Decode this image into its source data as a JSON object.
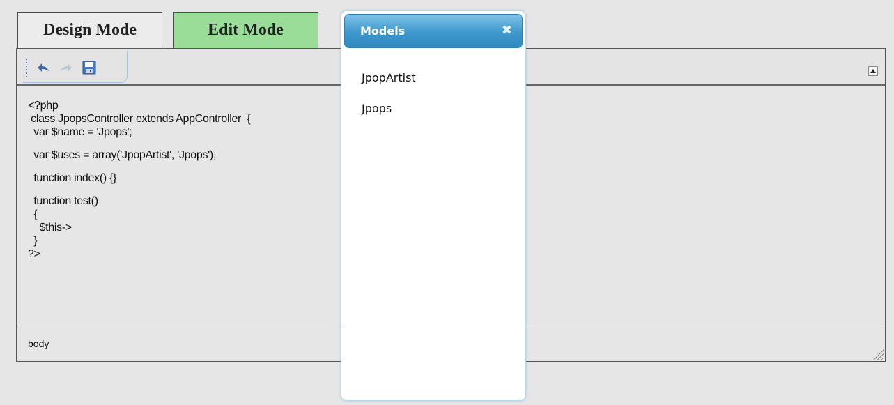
{
  "tabs": {
    "design_label": "Design Mode",
    "edit_label": "Edit Mode"
  },
  "toolbar": {
    "undo_icon": "undo-icon",
    "redo_icon": "redo-icon",
    "save_icon": "save-icon"
  },
  "code": {
    "lines": [
      "<?php",
      " class JpopsController extends AppController  {",
      "  var $name = 'Jpops';",
      "",
      "  var $uses = array('JpopArtist', 'Jpops');",
      "",
      "  function index() {}",
      "",
      "  function test()",
      "  {",
      "    $this->",
      "  }",
      "?>"
    ]
  },
  "statusbar": {
    "path": "body"
  },
  "models_popup": {
    "title": "Models",
    "close_glyph": "✖",
    "items": [
      "JpopArtist",
      "Jpops"
    ]
  },
  "colors": {
    "edit_tab_bg": "#99dd99",
    "popup_header": "#3e98cc"
  }
}
